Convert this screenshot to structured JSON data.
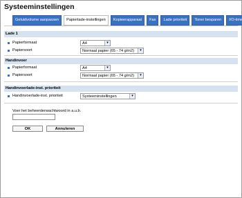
{
  "header": {
    "title": "Systeeminstellingen"
  },
  "tabs": [
    {
      "label": "Geluidvolume aanpassen"
    },
    {
      "label": "Papierlade-instellingen"
    },
    {
      "label": "Kopieerapparaat"
    },
    {
      "label": "Fax"
    },
    {
      "label": "Lade prioriteit"
    },
    {
      "label": "Toner besparen"
    },
    {
      "label": "I/O-time-out"
    }
  ],
  "sections": [
    {
      "title": "Lade 1",
      "rows": [
        {
          "label": "Papierformaat",
          "value": "A4"
        },
        {
          "label": "Papiersoort",
          "value": "Normaal papier (65 - 74 g/m2)"
        }
      ]
    },
    {
      "title": "Handinvoer",
      "rows": [
        {
          "label": "Papierformaat",
          "value": "A4"
        },
        {
          "label": "Papiersoort",
          "value": "Normaal papier (65 - 74 g/m2)"
        }
      ]
    },
    {
      "title": "Handinvoerlade-inst. prioriteit",
      "rows": [
        {
          "label": "Handinvoerlade-inst. prioriteit",
          "value": "Systeeminstellingen"
        }
      ]
    }
  ],
  "auth": {
    "prompt": "Voer het beheerderwachtwoord in a.u.b.",
    "password_value": ""
  },
  "actions": {
    "ok_label": "OK",
    "cancel_label": "Annuleren"
  },
  "colors": {
    "accent": "#3a72bf",
    "section_bg": "#d7e2f0"
  }
}
